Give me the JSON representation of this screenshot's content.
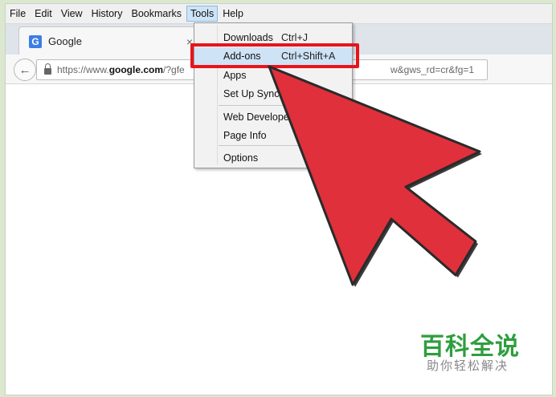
{
  "menubar": {
    "items": [
      "File",
      "Edit",
      "View",
      "History",
      "Bookmarks",
      "Tools",
      "Help"
    ],
    "active": "Tools"
  },
  "tab": {
    "favicon": "G",
    "title": "Google",
    "close": "×"
  },
  "navbar": {
    "url_prefix": "https://www.",
    "url_domain": "google.com",
    "url_path": "/?gfe",
    "url_tail": "w&gws_rd=cr&fg=1"
  },
  "tools_menu": {
    "items": [
      {
        "label": "Downloads",
        "shortcut": "Ctrl+J"
      },
      {
        "label": "Add-ons",
        "shortcut": "Ctrl+Shift+A",
        "highlighted": true
      },
      {
        "label": "Apps",
        "shortcut": ""
      },
      {
        "label": "Set Up Sync",
        "shortcut": ""
      },
      {
        "label": "Web Developer",
        "shortcut": ""
      },
      {
        "label": "Page Info",
        "shortcut": ""
      },
      {
        "label": "Options",
        "shortcut": ""
      }
    ]
  },
  "annotation": {
    "box_color": "#e8141b",
    "arrow_color": "#e0303b"
  },
  "watermark": {
    "title": "百科全说",
    "subtitle": "助你轻松解决"
  }
}
